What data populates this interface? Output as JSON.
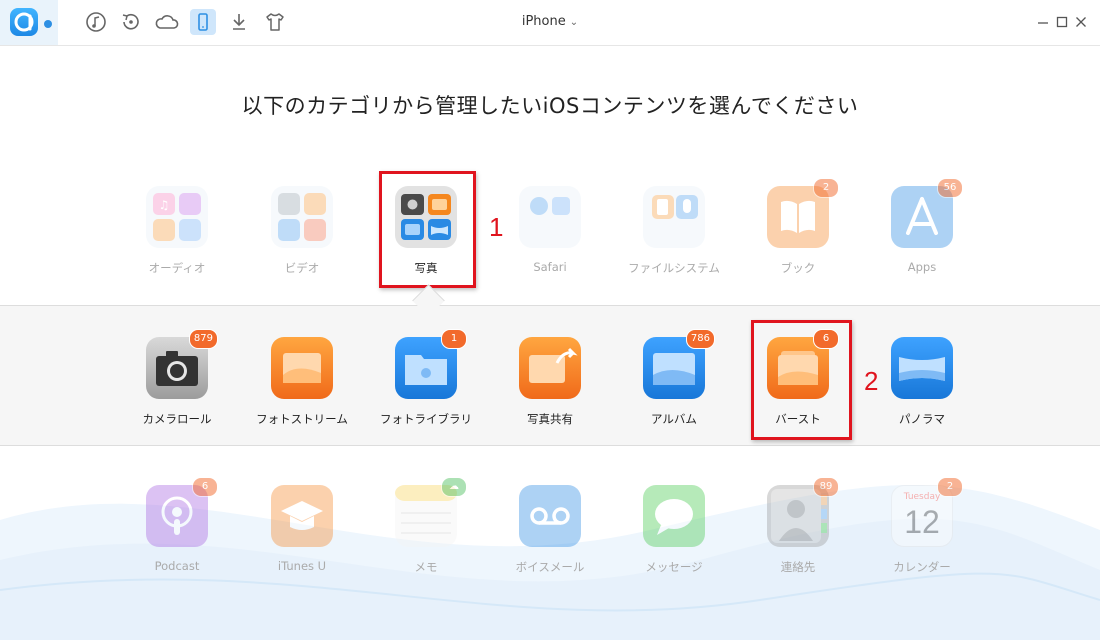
{
  "window": {
    "device_name": "iPhone",
    "toolbar_icons": [
      "app-logo-icon",
      "music-icon",
      "history-icon",
      "cloud-icon",
      "phone-icon",
      "download-icon",
      "shirt-icon"
    ],
    "controls": [
      "minimize-icon",
      "maximize-icon",
      "close-icon"
    ]
  },
  "heading": "以下のカテゴリから管理したいiOSコンテンツを選んでください",
  "top_categories": [
    {
      "label": "オーディオ",
      "badge": null,
      "icon": "audio-icon"
    },
    {
      "label": "ビデオ",
      "badge": null,
      "icon": "video-icon"
    },
    {
      "label": "写真",
      "badge": null,
      "icon": "photos-icon",
      "selected": true
    },
    {
      "label": "Safari",
      "badge": null,
      "icon": "safari-icon"
    },
    {
      "label": "ファイルシステム",
      "badge": null,
      "icon": "filesystem-icon"
    },
    {
      "label": "ブック",
      "badge": "2",
      "icon": "books-icon"
    },
    {
      "label": "Apps",
      "badge": "56",
      "icon": "appstore-icon"
    }
  ],
  "photo_categories": [
    {
      "label": "カメラロール",
      "badge": "879",
      "icon": "camera-icon"
    },
    {
      "label": "フォトストリーム",
      "badge": null,
      "icon": "photostream-icon"
    },
    {
      "label": "フォトライブラリ",
      "badge": "1",
      "icon": "photolibrary-icon"
    },
    {
      "label": "写真共有",
      "badge": null,
      "icon": "photo-share-icon"
    },
    {
      "label": "アルバム",
      "badge": "786",
      "icon": "album-icon"
    },
    {
      "label": "バースト",
      "badge": "6",
      "icon": "burst-icon",
      "selected": true
    },
    {
      "label": "パノラマ",
      "badge": null,
      "icon": "panorama-icon"
    }
  ],
  "bottom_categories": [
    {
      "label": "Podcast",
      "badge": "6",
      "icon": "podcast-icon"
    },
    {
      "label": "iTunes U",
      "badge": null,
      "icon": "itunes-u-icon"
    },
    {
      "label": "メモ",
      "badge": null,
      "icon": "notes-icon"
    },
    {
      "label": "ボイスメール",
      "badge": null,
      "icon": "voicemail-icon"
    },
    {
      "label": "メッセージ",
      "badge": null,
      "icon": "messages-icon"
    },
    {
      "label": "連絡先",
      "badge": "89",
      "icon": "contacts-icon"
    },
    {
      "label": "カレンダー",
      "badge": "2",
      "icon": "calendar-icon",
      "calendar_day": "Tuesday",
      "calendar_date": "12"
    }
  ],
  "annotations": {
    "step1": "1",
    "step2": "2"
  },
  "colors": {
    "accent": "#1e88e5",
    "badge": "#f26a2b",
    "highlight": "#e0141e"
  }
}
